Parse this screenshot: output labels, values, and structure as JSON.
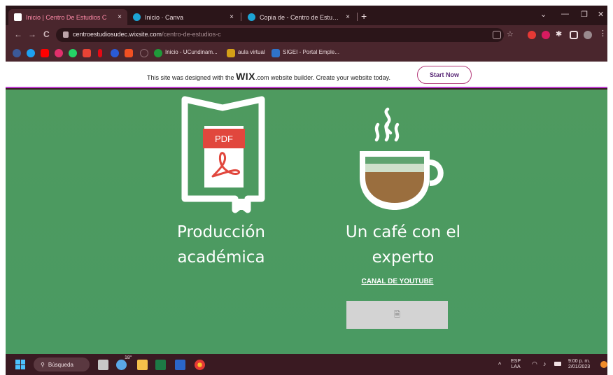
{
  "browser": {
    "tabs": [
      {
        "label": "Inicio | Centro De Estudios C",
        "active": true,
        "favicon_color": "#ffffff"
      },
      {
        "label": "Inicio · Canva",
        "active": false,
        "favicon_color": "#1ca4d4"
      },
      {
        "label": "Copia de - Centro de Estudios c",
        "active": false,
        "favicon_color": "#1ca4d4"
      }
    ],
    "close_glyph": "×",
    "new_tab_glyph": "+",
    "window_controls": [
      "⌄",
      "—",
      "❐",
      "✕"
    ],
    "nav": {
      "back": "←",
      "forward": "→",
      "reload": "C"
    },
    "url_main": "centroestudiosudec.wixsite.com",
    "url_path": "/centro-de-estudios-c",
    "bookmarks": [
      {
        "label": "Inicio - UCundinam...",
        "icon_color": "#1f9a3a"
      },
      {
        "label": "aula virtual",
        "icon_color": "#d4a017"
      },
      {
        "label": "SIGEI - Portal Emple...",
        "icon_color": "#2f73c9"
      }
    ]
  },
  "wix_banner": {
    "text_before": "This site was designed with the ",
    "brand": "WIX",
    "text_after": ".com website builder. Create your website today.",
    "button_label": "Start Now"
  },
  "page": {
    "pdf_badge": "PDF",
    "left_title_line1": "Producción",
    "left_title_line2": "académica",
    "right_title_line1": "Un café con el",
    "right_title_line2": "experto",
    "youtube_link": "CANAL DE YOUTUBE",
    "video_icon": "🗎"
  },
  "taskbar": {
    "search_label": "Búsqueda",
    "weather": "18°",
    "lang_line1": "ESP",
    "lang_line2": "LAA",
    "time": "9:00 p. m.",
    "date": "2/01/2023"
  },
  "colors": {
    "page_green": "#4e9a5f",
    "browser_frame": "#4a262d",
    "wix_accent": "#bd3fd0",
    "pdf_red": "#e1473d"
  }
}
